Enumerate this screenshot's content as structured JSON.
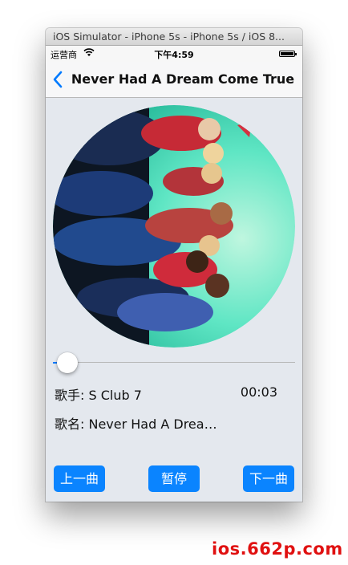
{
  "window": {
    "title": "iOS Simulator - iPhone 5s - iPhone 5s / iOS 8..."
  },
  "status_bar": {
    "carrier": "运营商",
    "time": "下午4:59"
  },
  "nav": {
    "title": "Never Had A Dream Come True"
  },
  "player": {
    "progress": 0.06,
    "artist_label": "歌手: S Club 7",
    "elapsed": "00:03",
    "song_label": "歌名: Never Had A Drea…"
  },
  "controls": {
    "prev": "上一曲",
    "pause": "暂停",
    "next": "下一曲"
  },
  "watermark": "ios.662p.com",
  "colors": {
    "accent": "#007aff",
    "button": "#0a84ff",
    "watermark": "#e01010"
  }
}
